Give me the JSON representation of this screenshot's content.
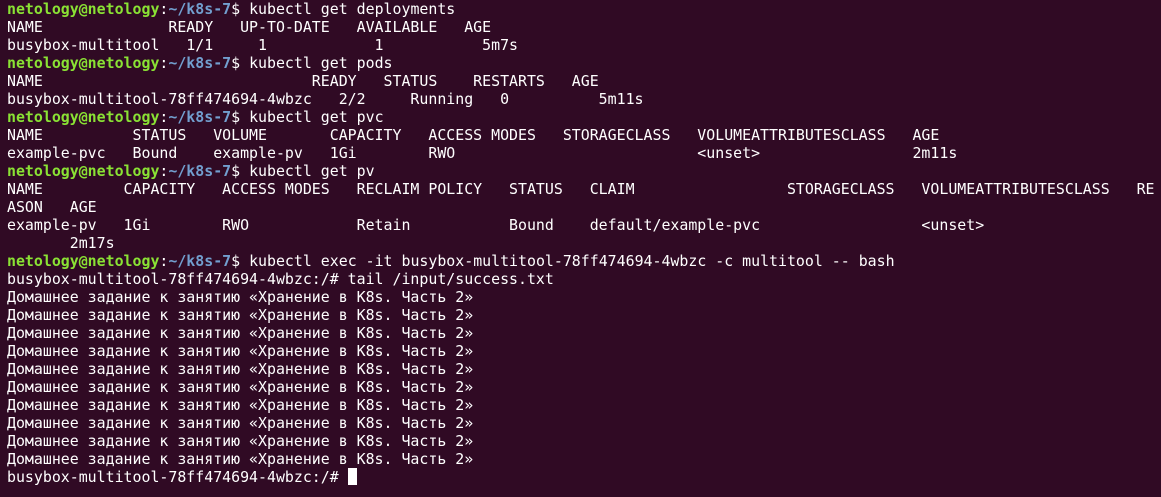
{
  "terminal": {
    "prompt": {
      "user_host": "netology@netology",
      "separator": ":",
      "path": "~/k8s-7",
      "symbol": "$"
    },
    "lines": [
      {
        "type": "prompt",
        "command": " kubectl get deployments"
      },
      {
        "type": "output",
        "text": "NAME              READY   UP-TO-DATE   AVAILABLE   AGE"
      },
      {
        "type": "output",
        "text": "busybox-multitool   1/1     1            1           5m7s"
      },
      {
        "type": "prompt",
        "command": " kubectl get pods"
      },
      {
        "type": "output",
        "text": "NAME                              READY   STATUS    RESTARTS   AGE"
      },
      {
        "type": "output",
        "text": "busybox-multitool-78ff474694-4wbzc   2/2     Running   0          5m11s"
      },
      {
        "type": "prompt",
        "command": " kubectl get pvc"
      },
      {
        "type": "output",
        "text": "NAME          STATUS   VOLUME       CAPACITY   ACCESS MODES   STORAGECLASS   VOLUMEATTRIBUTESCLASS   AGE"
      },
      {
        "type": "output",
        "text": "example-pvc   Bound    example-pv   1Gi        RWO                           <unset>                 2m11s"
      },
      {
        "type": "prompt",
        "command": " kubectl get pv"
      },
      {
        "type": "output",
        "text": "NAME         CAPACITY   ACCESS MODES   RECLAIM POLICY   STATUS   CLAIM                 STORAGECLASS   VOLUMEATTRIBUTESCLASS   RE"
      },
      {
        "type": "output",
        "text": "ASON   AGE"
      },
      {
        "type": "output",
        "text": "example-pv   1Gi        RWO            Retain           Bound    default/example-pvc                  <unset>"
      },
      {
        "type": "output",
        "text": "       2m17s"
      },
      {
        "type": "prompt",
        "command": " kubectl exec -it busybox-multitool-78ff474694-4wbzc -c multitool -- bash"
      },
      {
        "type": "output",
        "text": "busybox-multitool-78ff474694-4wbzc:/# tail /input/success.txt"
      },
      {
        "type": "output",
        "text": "Домашнее задание к занятию «Хранение в K8s. Часть 2»"
      },
      {
        "type": "output",
        "text": "Домашнее задание к занятию «Хранение в K8s. Часть 2»"
      },
      {
        "type": "output",
        "text": "Домашнее задание к занятию «Хранение в K8s. Часть 2»"
      },
      {
        "type": "output",
        "text": "Домашнее задание к занятию «Хранение в K8s. Часть 2»"
      },
      {
        "type": "output",
        "text": "Домашнее задание к занятию «Хранение в K8s. Часть 2»"
      },
      {
        "type": "output",
        "text": "Домашнее задание к занятию «Хранение в K8s. Часть 2»"
      },
      {
        "type": "output",
        "text": "Домашнее задание к занятию «Хранение в K8s. Часть 2»"
      },
      {
        "type": "output",
        "text": "Домашнее задание к занятию «Хранение в K8s. Часть 2»"
      },
      {
        "type": "output",
        "text": "Домашнее задание к занятию «Хранение в K8s. Часть 2»"
      },
      {
        "type": "output",
        "text": "Домашнее задание к занятию «Хранение в K8s. Часть 2»"
      },
      {
        "type": "cursor",
        "text": "busybox-multitool-78ff474694-4wbzc:/# "
      }
    ]
  },
  "colors": {
    "background": "#300a24",
    "user_host": "#8ae234",
    "path": "#729fcf",
    "text": "#ffffff"
  }
}
